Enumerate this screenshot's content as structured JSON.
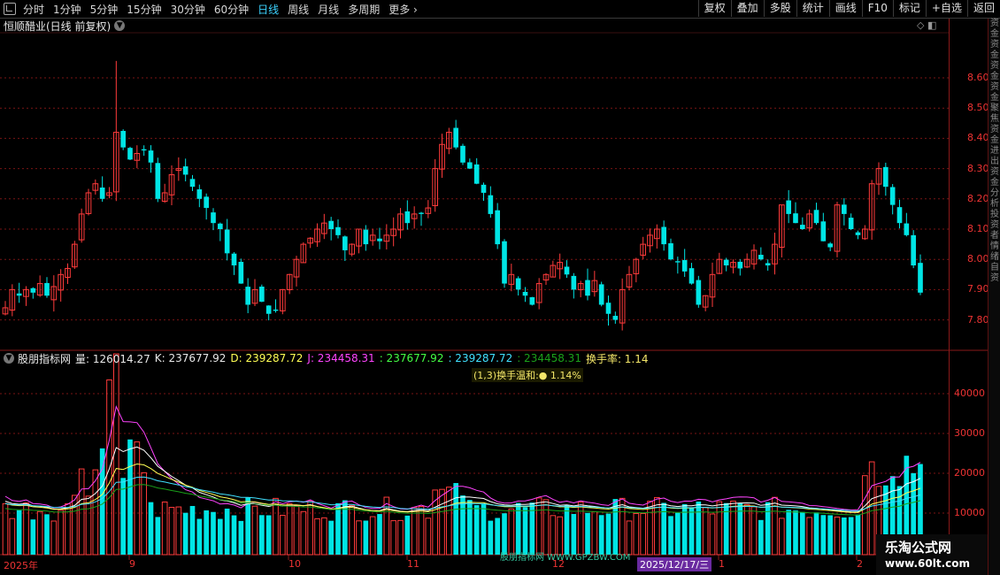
{
  "toolbar": {
    "periods": [
      "分时",
      "1分钟",
      "5分钟",
      "15分钟",
      "30分钟",
      "60分钟",
      "日线",
      "周线",
      "月线",
      "多周期",
      "更多"
    ],
    "active": "日线",
    "right_buttons": [
      "复权",
      "叠加",
      "多股",
      "统计",
      "画线",
      "F10",
      "标记",
      "+自选",
      "返回"
    ]
  },
  "title": "恒顺醋业(日线 前复权)",
  "corner_icons": "◇ ◧",
  "side_strip_text": [
    "资",
    "金",
    "资",
    "金",
    "资",
    "金",
    "资",
    "金",
    "聚",
    "焦",
    "资",
    "金",
    "进",
    "出",
    "资",
    "金",
    "分",
    "析",
    "投",
    "资",
    "者",
    "情",
    "绪",
    "自",
    "资"
  ],
  "price_axis": [
    "8.60",
    "8.50",
    "8.40",
    "8.30",
    "8.20",
    "8.10",
    "8.00",
    "7.90",
    "7.80"
  ],
  "volume_axis": [
    "40000",
    "30000",
    "20000",
    "10000"
  ],
  "indicator": {
    "name": "股朋指标网",
    "vol_label": "量: 126014.27",
    "k_label": "K: 237677.92",
    "d_label": "D: 239287.72",
    "j_label": "J: 234458.31",
    "v1": ": 237677.92",
    "v2": ": 239287.72",
    "v3": ": 234458.31",
    "turnover": "换手率: 1.14"
  },
  "note": "(1,3)换手温和:● 1.14%",
  "dates": [
    "2025年",
    "9",
    "10",
    "11",
    "12",
    "1",
    "2"
  ],
  "selected_date": "2025/12/17/三",
  "watermark": "股朋指标网 WWW.GPZBW.COM",
  "brand": {
    "line1": "乐淘公式网",
    "line2": "www.60lt.com"
  },
  "colors": {
    "up": "#ff3b3b",
    "down": "#00e5e5",
    "k": "#ffffff",
    "d": "#ffff55",
    "j": "#ff44ff"
  }
}
